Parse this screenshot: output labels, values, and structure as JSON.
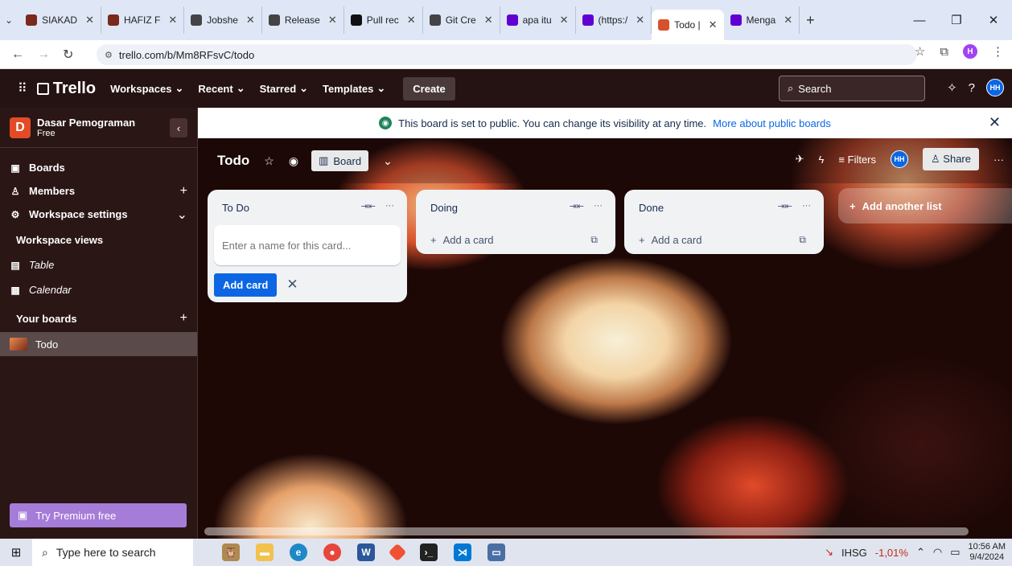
{
  "browser": {
    "tabs": [
      {
        "label": "SIAKAD",
        "fav": "#7a2a1a"
      },
      {
        "label": "HAFIZ F",
        "fav": "#7a2a1a"
      },
      {
        "label": "Jobshe",
        "fav": "#444444"
      },
      {
        "label": "Release",
        "fav": "#444444"
      },
      {
        "label": "Pull rec",
        "fav": "#111111"
      },
      {
        "label": "Git Cre",
        "fav": "#444444"
      },
      {
        "label": "apa itu",
        "fav": "#6001d2"
      },
      {
        "label": "(https:/",
        "fav": "#6001d2"
      },
      {
        "label": "Todo |",
        "fav": "#d9502d",
        "active": true
      },
      {
        "label": "Menga",
        "fav": "#6001d2"
      }
    ],
    "new_tab": "+",
    "url": "trello.com/b/Mm8RFsvC/todo",
    "profile_initial": "H"
  },
  "header": {
    "logo": "Trello",
    "menus": [
      "Workspaces",
      "Recent",
      "Starred",
      "Templates"
    ],
    "create": "Create",
    "search_placeholder": "Search",
    "avatar": "HH"
  },
  "sidebar": {
    "workspace_initial": "D",
    "workspace_name": "Dasar Pemograman",
    "workspace_plan": "Free",
    "items": [
      {
        "label": "Boards",
        "icon": "board-icon"
      },
      {
        "label": "Members",
        "icon": "members-icon",
        "trail": "+"
      },
      {
        "label": "Workspace settings",
        "icon": "settings-icon",
        "trail": "⌄"
      }
    ],
    "views_heading": "Workspace views",
    "views": [
      {
        "label": "Table",
        "icon": "table-icon"
      },
      {
        "label": "Calendar",
        "icon": "calendar-icon"
      }
    ],
    "boards_heading": "Your boards",
    "boards": [
      {
        "label": "Todo"
      }
    ],
    "premium": "Try Premium free"
  },
  "board": {
    "banner_text": "This board is set to public. You can change its visibility at any time.",
    "banner_link": "More about public boards",
    "title": "Todo",
    "view": "Board",
    "filters": "Filters",
    "share": "Share",
    "lists": [
      {
        "name": "To Do",
        "composer_placeholder": "Enter a name for this card...",
        "add_button": "Add card"
      },
      {
        "name": "Doing",
        "add_card": "Add a card"
      },
      {
        "name": "Done",
        "add_card": "Add a card"
      }
    ],
    "add_list": "Add another list"
  },
  "taskbar": {
    "search_placeholder": "Type here to search",
    "stock_name": "IHSG",
    "stock_change": "-1,01%",
    "time": "10:56 AM",
    "date": "9/4/2024"
  }
}
